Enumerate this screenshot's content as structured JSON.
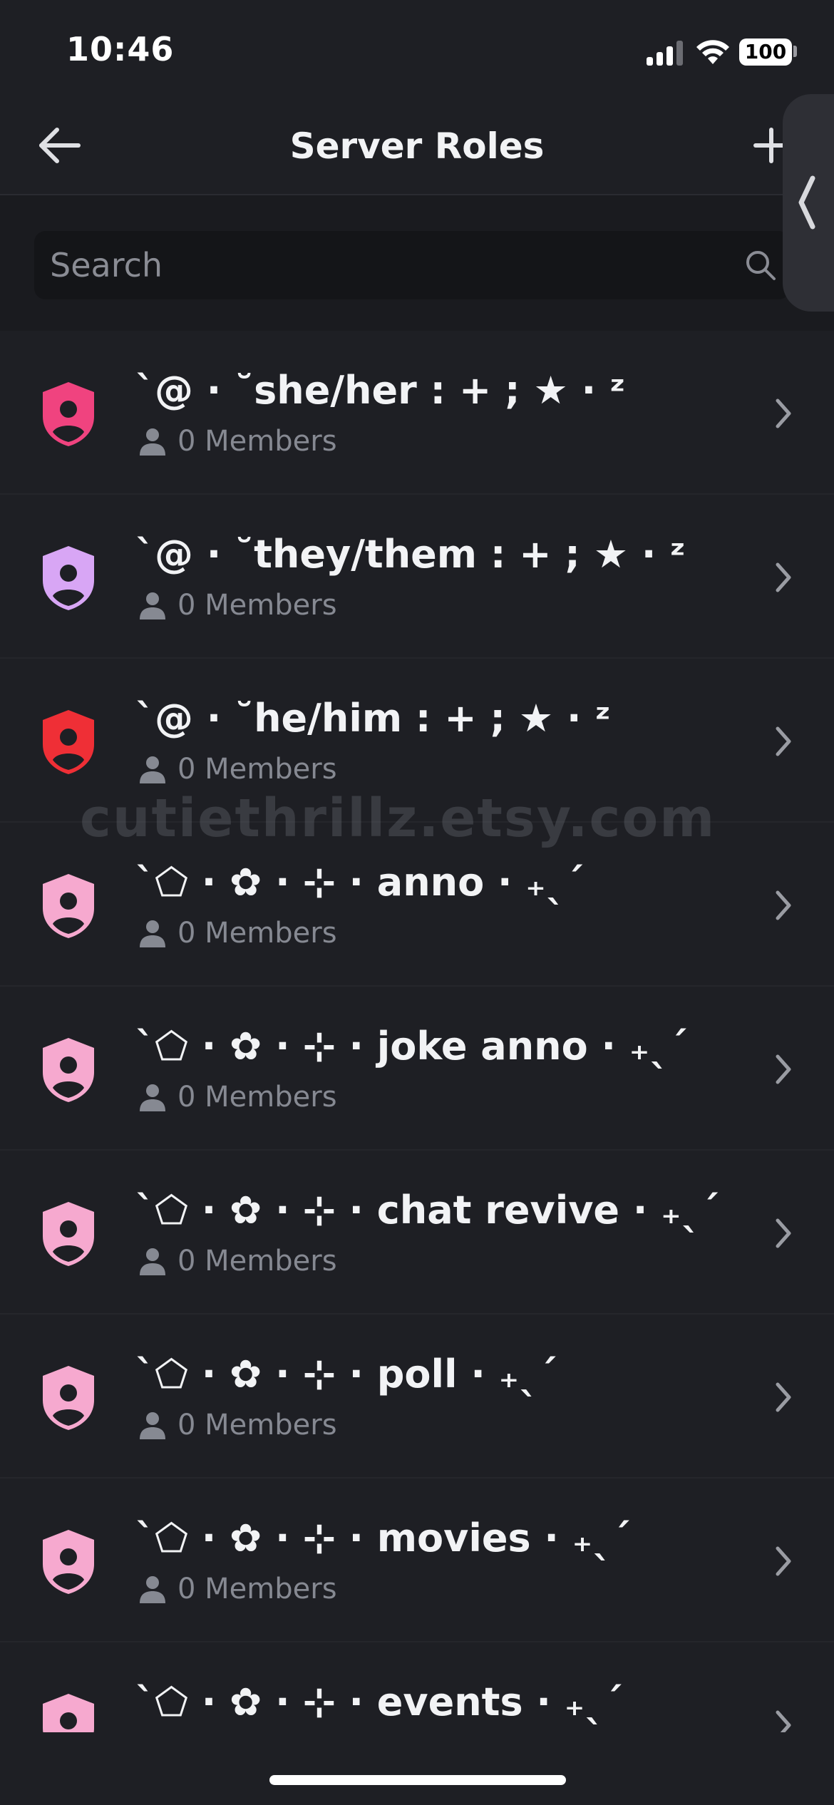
{
  "status_bar": {
    "time": "10:46",
    "battery": "100"
  },
  "header": {
    "title": "Server Roles",
    "back_icon": "arrow-left-icon",
    "add_icon": "plus-icon"
  },
  "search": {
    "placeholder": "Search",
    "icon": "search-icon"
  },
  "watermark": "cutiethrillz.etsy.com",
  "roles": [
    {
      "name": "`@ · ˘she/her : + ; ★ · ᶻ",
      "members": "0 Members",
      "color": "#f0437f"
    },
    {
      "name": "`@ · ˘they/them : + ; ★ · ᶻ",
      "members": "0 Members",
      "color": "#d8a6f5"
    },
    {
      "name": "`@ · ˘he/him : + ; ★ · ᶻ",
      "members": "0 Members",
      "color": "#ef2f36"
    },
    {
      "name": "`⬠ · ✿ · ⊹ · anno · ₊ˎˊ",
      "members": "0 Members",
      "color": "#f6a9cf"
    },
    {
      "name": "`⬠ · ✿ · ⊹ · joke anno · ₊ˎˊ",
      "members": "0 Members",
      "color": "#f6a9cf"
    },
    {
      "name": "`⬠ · ✿ · ⊹ · chat revive · ₊ˎˊ",
      "members": "0 Members",
      "color": "#f6a9cf"
    },
    {
      "name": "`⬠ · ✿ · ⊹ · poll · ₊ˎˊ",
      "members": "0 Members",
      "color": "#f6a9cf"
    },
    {
      "name": "`⬠ · ✿ · ⊹ · movies · ₊ˎˊ",
      "members": "0 Members",
      "color": "#f6a9cf"
    },
    {
      "name": "`⬠ · ✿ · ⊹ · events · ₊ˎˊ",
      "members": "",
      "color": "#f6a9cf"
    }
  ]
}
